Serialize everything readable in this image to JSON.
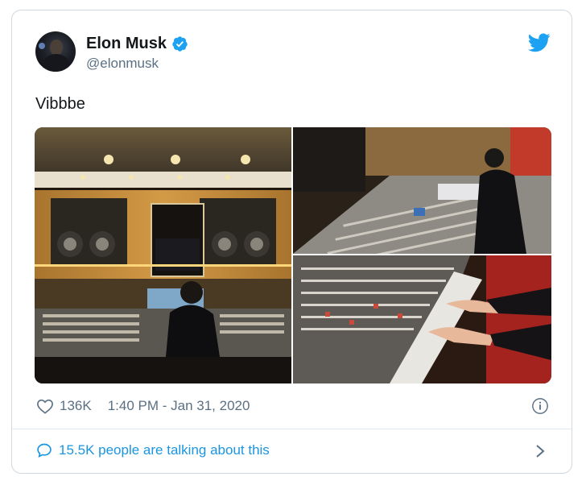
{
  "tweet": {
    "display_name": "Elon Musk",
    "handle": "@elonmusk",
    "text": "Vibbbe",
    "likes": "136K",
    "timestamp": "1:40 PM - Jan 31, 2020",
    "talking": "15.5K people are talking about this"
  },
  "icons": {
    "verified": "verified-badge-icon",
    "brand": "twitter-bird-icon",
    "like": "heart-icon",
    "info": "info-icon",
    "reply": "speech-bubble-icon",
    "more": "chevron-right-icon"
  },
  "colors": {
    "brand_blue": "#1da1f2",
    "link_blue": "#1b95e0",
    "secondary_text": "#5b7083",
    "border": "#cfd9de"
  },
  "media": {
    "count": 3
  }
}
